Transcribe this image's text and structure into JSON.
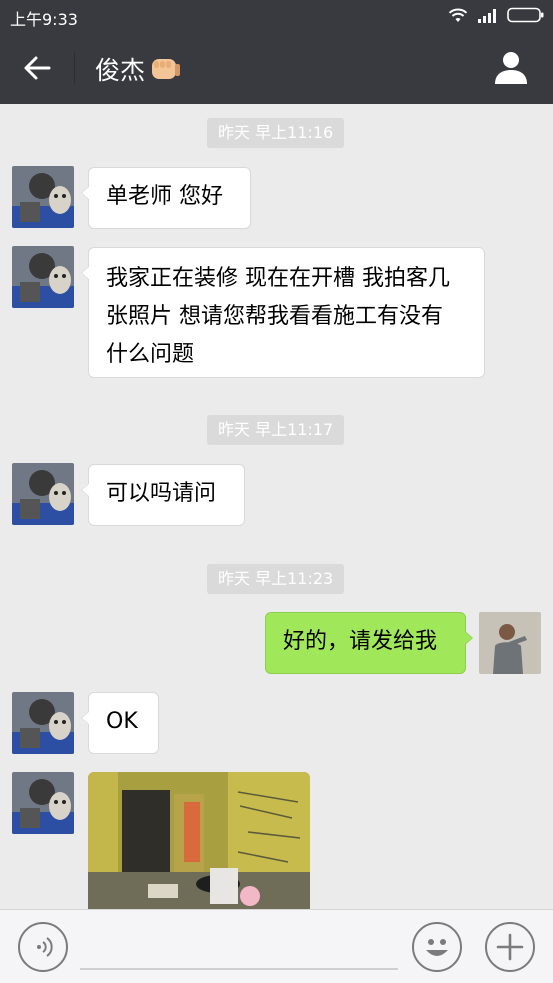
{
  "status_bar": {
    "time": "上午9:33"
  },
  "header": {
    "title": "俊杰"
  },
  "messages": {
    "ts1": "昨天 早上11:16",
    "m1": "单老师 您好",
    "m2_line1": "我家正在装修 现在在开槽 我拍客几",
    "m2_line2": "张照片 想请您帮我看看施工有没有",
    "m2_line3": "什么问题",
    "ts2": "昨天 早上11:17",
    "m3": "可以吗请问",
    "ts3": "昨天 早上11:23",
    "m4": "好的，请发给我",
    "m5": "OK"
  },
  "colors": {
    "header_bg": "#393a3f",
    "chat_bg": "#ebebeb",
    "sent_bubble": "#a0e75a",
    "received_bubble": "#ffffff",
    "timestamp_bg": "#dadada"
  },
  "icons": {
    "back": "back-arrow-icon",
    "profile": "person-icon",
    "title_emoji": "fist-bump-emoji",
    "voice": "voice-icon",
    "emoji": "smiley-icon",
    "more": "plus-icon"
  }
}
